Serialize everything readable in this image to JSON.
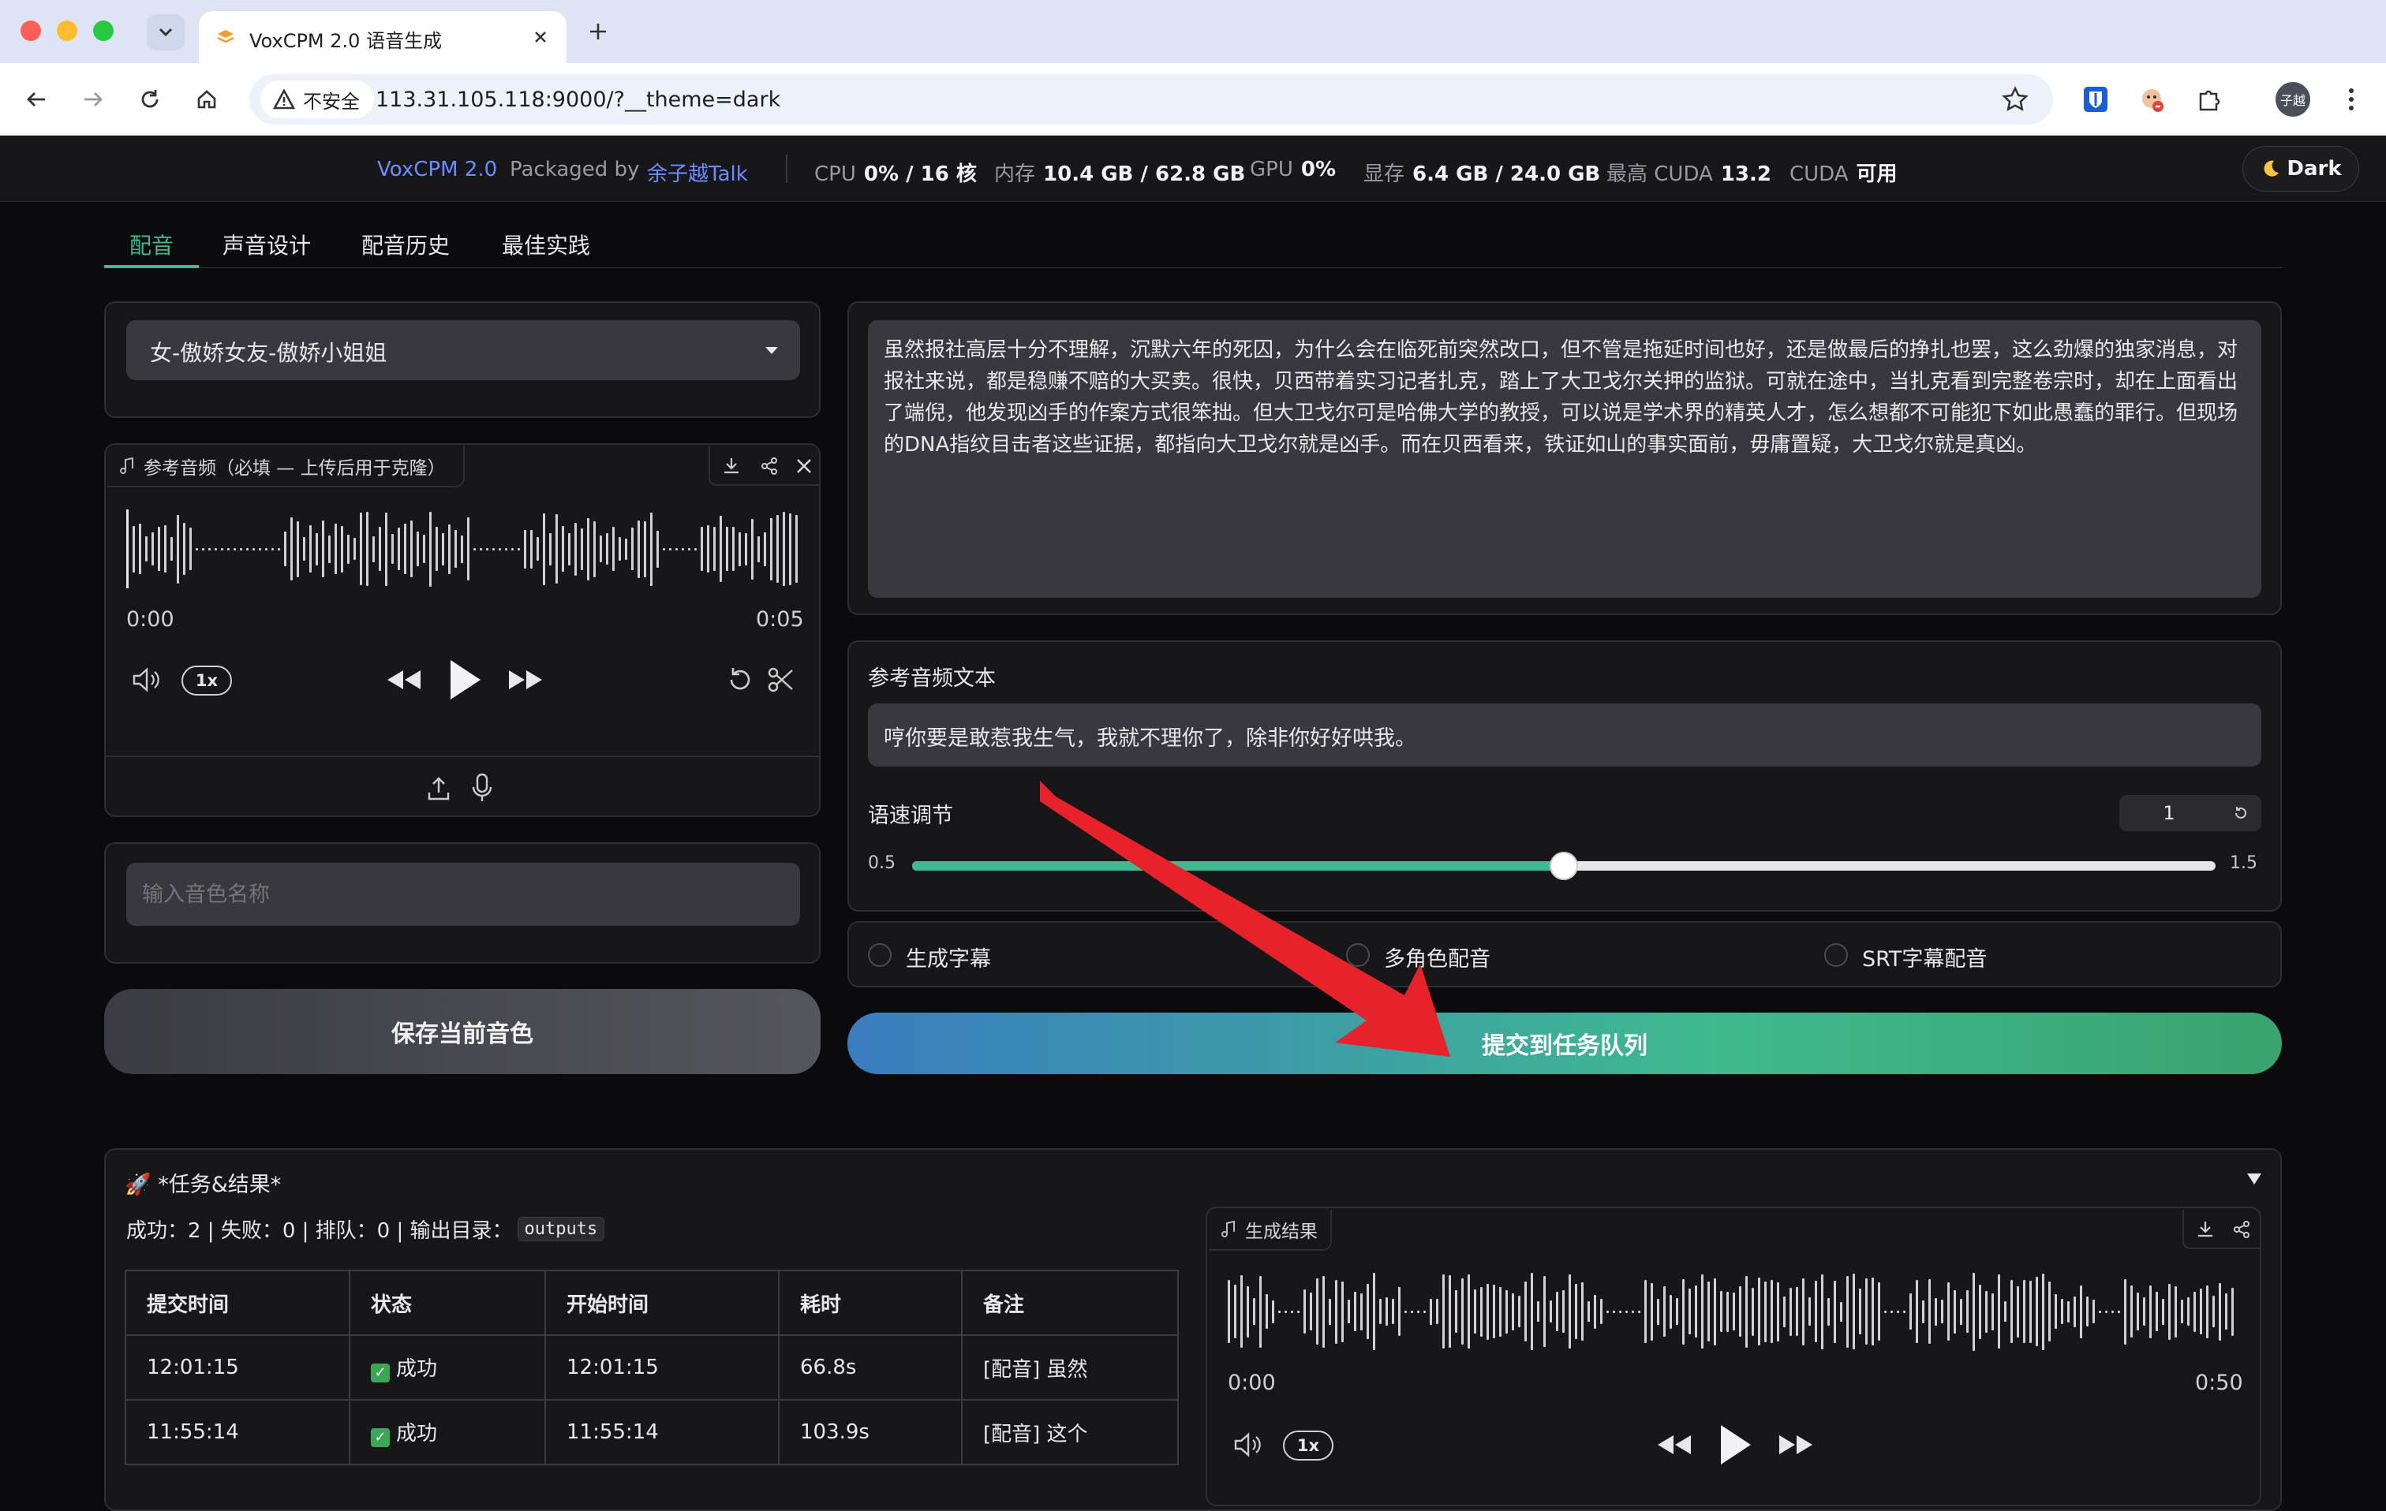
{
  "browser": {
    "tab_title": "VoxCPM 2.0 语音生成",
    "security_label": "不安全",
    "url": "113.31.105.118:9000/?__theme=dark",
    "profile_initials": "子越"
  },
  "header": {
    "app_name": "VoxCPM 2.0",
    "packaged_by_label": "Packaged by",
    "author": "余子越Talk",
    "stats": [
      {
        "label": "CPU",
        "value": "0% / 16 核"
      },
      {
        "label": "内存",
        "value": "10.4 GB / 62.8 GB"
      },
      {
        "label": "GPU",
        "value": "0%"
      },
      {
        "label": "显存",
        "value": "6.4 GB / 24.0 GB"
      },
      {
        "label": "最高 CUDA",
        "value": "13.2"
      },
      {
        "label": "CUDA",
        "value": "可用"
      }
    ],
    "theme_button": "Dark"
  },
  "tabs": [
    "配音",
    "声音设计",
    "配音历史",
    "最佳实践"
  ],
  "voice_select": {
    "value": "女-傲娇女友-傲娇小姐姐"
  },
  "ref_audio": {
    "label": "参考音频（必填 — 上传后用于克隆）",
    "time_current": "0:00",
    "time_total": "0:05",
    "speed": "1x"
  },
  "voice_name": {
    "placeholder": "输入音色名称"
  },
  "save_button": "保存当前音色",
  "main_text": "虽然报社高层十分不理解，沉默六年的死囚，为什么会在临死前突然改口，但不管是拖延时间也好，还是做最后的挣扎也罢，这么劲爆的独家消息，对报社来说，都是稳赚不赔的大买卖。很快，贝西带着实习记者扎克，踏上了大卫戈尔关押的监狱。可就在途中，当扎克看到完整卷宗时，却在上面看出了端倪，他发现凶手的作案方式很笨拙。但大卫戈尔可是哈佛大学的教授，可以说是学术界的精英人才，怎么想都不可能犯下如此愚蠢的罪行。但现场的DNA指纹目击者这些证据，都指向大卫戈尔就是凶手。而在贝西看来，铁证如山的事实面前，毋庸置疑，大卫戈尔就是真凶。",
  "ref_text": {
    "label": "参考音频文本",
    "value": "哼你要是敢惹我生气，我就不理你了，除非你好好哄我。"
  },
  "speed": {
    "label": "语速调节",
    "value": "1",
    "min": "0.5",
    "max": "1.5",
    "fraction": 0.5
  },
  "options": [
    "生成字幕",
    "多角色配音",
    "SRT字幕配音"
  ],
  "submit_button": "提交到任务队列",
  "tasks": {
    "title": "🚀 *任务&结果*",
    "summary": "成功：2 | 失败：0 | 排队：0 | 输出目录：",
    "output_dir": "outputs",
    "columns": [
      "提交时间",
      "状态",
      "开始时间",
      "耗时",
      "备注"
    ],
    "rows": [
      [
        "12:01:15",
        "成功",
        "12:01:15",
        "66.8s",
        "[配音] 虽然"
      ],
      [
        "11:55:14",
        "成功",
        "11:55:14",
        "103.9s",
        "[配音] 这个"
      ]
    ]
  },
  "result_audio": {
    "label": "生成结果",
    "time_current": "0:00",
    "time_total": "0:50",
    "speed": "1x"
  },
  "colors": {
    "accent_green": "#3fb98f",
    "link_blue": "#6c8cff",
    "annotation_arrow": "#e8222a"
  }
}
